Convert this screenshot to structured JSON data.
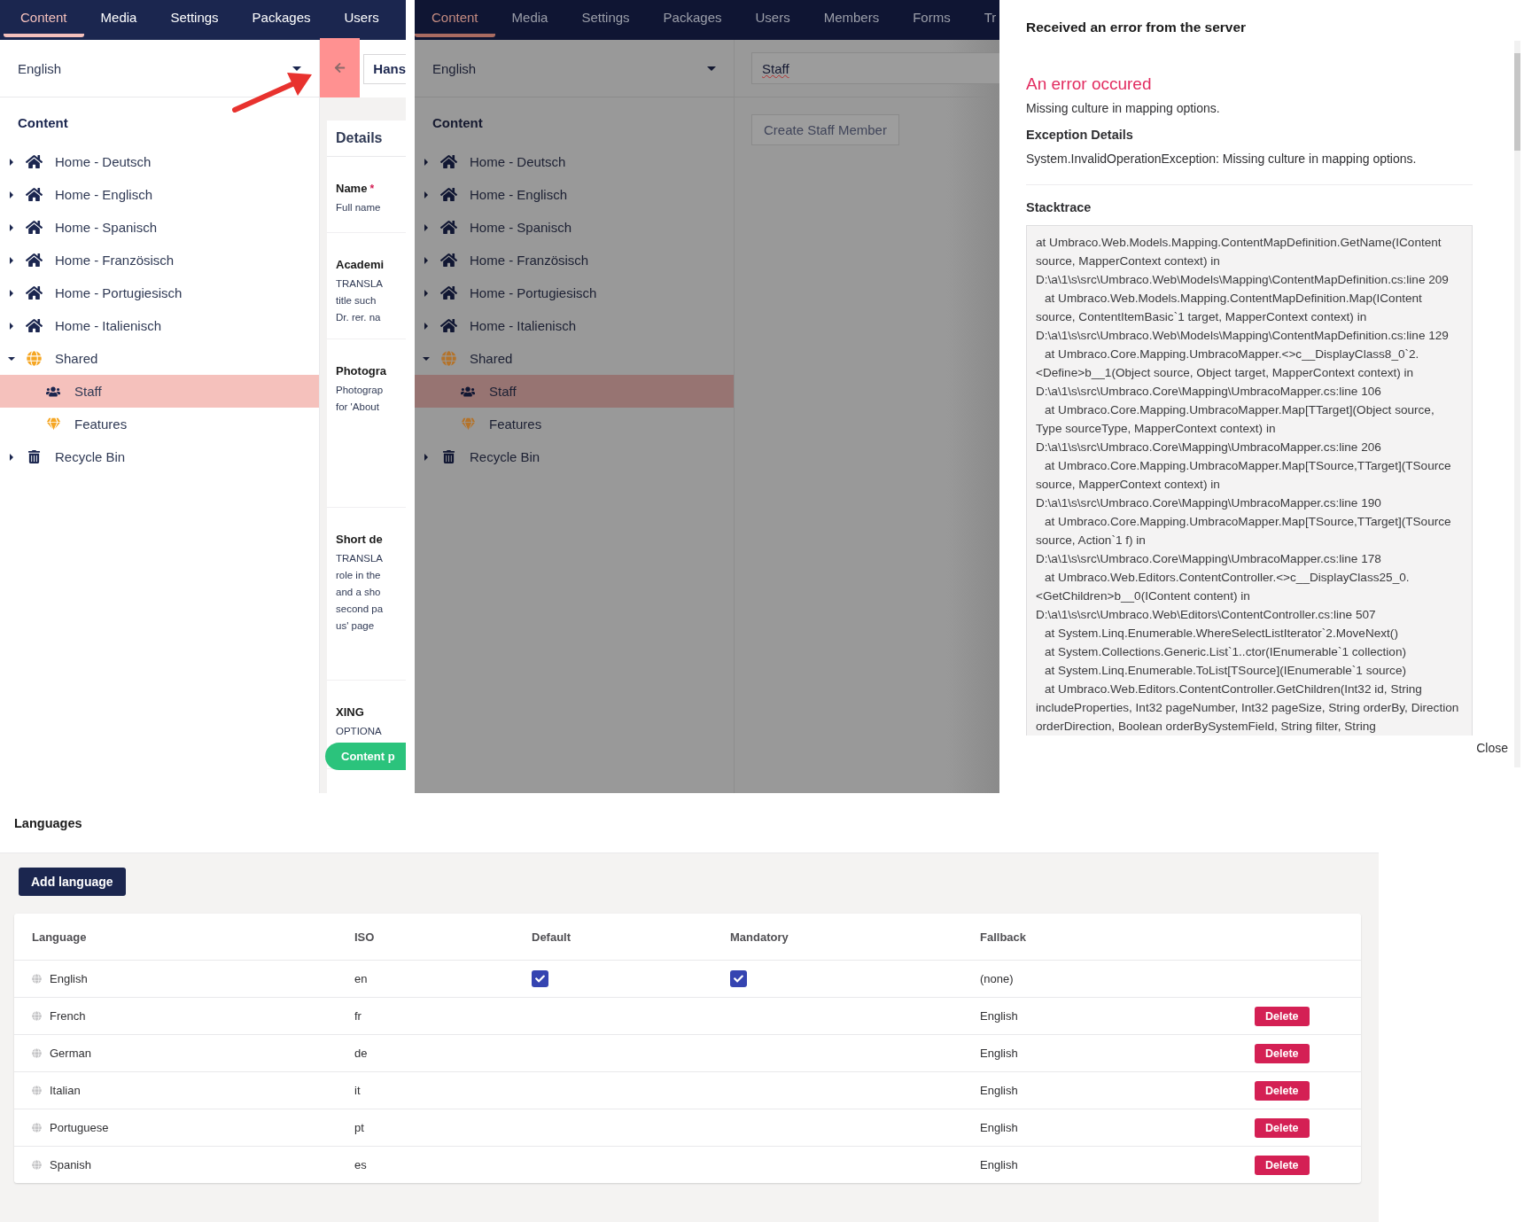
{
  "admin_view": {
    "nav_tabs": [
      {
        "label": "Content",
        "selected": true
      },
      {
        "label": "Media",
        "selected": false
      },
      {
        "label": "Settings",
        "selected": false
      },
      {
        "label": "Packages",
        "selected": false
      },
      {
        "label": "Users",
        "selected": false
      }
    ],
    "language_select": {
      "value": "English"
    },
    "tree_title": "Content",
    "tree": [
      {
        "label": "Home - Deutsch",
        "kind": "home",
        "expanded": false,
        "selected": false
      },
      {
        "label": "Home - Englisch",
        "kind": "home",
        "expanded": false,
        "selected": false
      },
      {
        "label": "Home - Spanisch",
        "kind": "home",
        "expanded": false,
        "selected": false
      },
      {
        "label": "Home - Französisch",
        "kind": "home",
        "expanded": false,
        "selected": false
      },
      {
        "label": "Home - Portugiesisch",
        "kind": "home",
        "expanded": false,
        "selected": false
      },
      {
        "label": "Home - Italienisch",
        "kind": "home",
        "expanded": false,
        "selected": false
      },
      {
        "label": "Shared",
        "kind": "globe",
        "expanded": true,
        "selected": false,
        "children": [
          {
            "label": "Staff",
            "kind": "staff",
            "selected": true
          },
          {
            "label": "Features",
            "kind": "features",
            "selected": false
          }
        ]
      },
      {
        "label": "Recycle Bin",
        "kind": "trash",
        "expanded": false,
        "selected": false
      }
    ],
    "back_button": {
      "highlighted": true
    },
    "annotation_arrow": true,
    "name_field": {
      "value": "Hans"
    },
    "editor": {
      "group_title": "Details",
      "fields": [
        {
          "label": "Name",
          "required_mark": "*",
          "description": [
            "Full name"
          ]
        },
        {
          "label": "Academi",
          "description": [
            "TRANSLA",
            "title such",
            "Dr. rer. na"
          ]
        },
        {
          "label": "Photogra",
          "description": [
            "Photograp",
            "for 'About"
          ]
        },
        {
          "label": "Short de",
          "description": [
            "TRANSLA",
            "role in the",
            "and a sho",
            "second pa",
            "us' page"
          ]
        },
        {
          "label": "XING",
          "description": [
            "OPTIONA"
          ]
        }
      ]
    },
    "save_button": "Content p"
  },
  "dimmed_view": {
    "nav_tabs": [
      {
        "label": "Content",
        "selected": true
      },
      {
        "label": "Media",
        "selected": false
      },
      {
        "label": "Settings",
        "selected": false
      },
      {
        "label": "Packages",
        "selected": false
      },
      {
        "label": "Users",
        "selected": false
      },
      {
        "label": "Members",
        "selected": false
      },
      {
        "label": "Forms",
        "selected": false
      },
      {
        "label": "Tr",
        "selected": false
      }
    ],
    "language_select": {
      "value": "English"
    },
    "tree_title": "Content",
    "tree": [
      {
        "label": "Home - Deutsch",
        "kind": "home",
        "expanded": false,
        "selected": false
      },
      {
        "label": "Home - Englisch",
        "kind": "home",
        "expanded": false,
        "selected": false
      },
      {
        "label": "Home - Spanisch",
        "kind": "home",
        "expanded": false,
        "selected": false
      },
      {
        "label": "Home - Französisch",
        "kind": "home",
        "expanded": false,
        "selected": false
      },
      {
        "label": "Home - Portugiesisch",
        "kind": "home",
        "expanded": false,
        "selected": false
      },
      {
        "label": "Home - Italienisch",
        "kind": "home",
        "expanded": false,
        "selected": false
      },
      {
        "label": "Shared",
        "kind": "globe",
        "expanded": true,
        "selected": false,
        "children": [
          {
            "label": "Staff",
            "kind": "staff",
            "selected": true
          },
          {
            "label": "Features",
            "kind": "features",
            "selected": false
          }
        ]
      },
      {
        "label": "Recycle Bin",
        "kind": "trash",
        "expanded": false,
        "selected": false
      }
    ],
    "name_field": {
      "value": "Staff"
    },
    "create_button": "Create Staff Member"
  },
  "error_dialog": {
    "title": "Received an error from the server",
    "heading": "An error occured",
    "message": "Missing culture in mapping options.",
    "exception_title": "Exception Details",
    "exception": "System.InvalidOperationException: Missing culture in mapping options.",
    "stacktrace_title": "Stacktrace",
    "stacktrace": [
      "at Umbraco.Web.Models.Mapping.ContentMapDefinition.GetName(IContent source, MapperContext context) in D:\\a\\1\\s\\src\\Umbraco.Web\\Models\\Mapping\\ContentMapDefinition.cs:line 209",
      "at Umbraco.Web.Models.Mapping.ContentMapDefinition.Map(IContent source, ContentItemBasic`1 target, MapperContext context) in D:\\a\\1\\s\\src\\Umbraco.Web\\Models\\Mapping\\ContentMapDefinition.cs:line 129",
      "at Umbraco.Core.Mapping.UmbracoMapper.<>c__DisplayClass8_0`2.<Define>b__1(Object source, Object target, MapperContext context) in D:\\a\\1\\s\\src\\Umbraco.Core\\Mapping\\UmbracoMapper.cs:line 106",
      "at Umbraco.Core.Mapping.UmbracoMapper.Map[TTarget](Object source, Type sourceType, MapperContext context) in D:\\a\\1\\s\\src\\Umbraco.Core\\Mapping\\UmbracoMapper.cs:line 206",
      "at Umbraco.Core.Mapping.UmbracoMapper.Map[TSource,TTarget](TSource source, MapperContext context) in D:\\a\\1\\s\\src\\Umbraco.Core\\Mapping\\UmbracoMapper.cs:line 190",
      "at Umbraco.Core.Mapping.UmbracoMapper.Map[TSource,TTarget](TSource source, Action`1 f) in D:\\a\\1\\s\\src\\Umbraco.Core\\Mapping\\UmbracoMapper.cs:line 178",
      "at Umbraco.Web.Editors.ContentController.<>c__DisplayClass25_0.<GetChildren>b__0(IContent content) in D:\\a\\1\\s\\src\\Umbraco.Web\\Editors\\ContentController.cs:line 507",
      "at System.Linq.Enumerable.WhereSelectListIterator`2.MoveNext()",
      "at System.Collections.Generic.List`1..ctor(IEnumerable`1 collection)",
      "at System.Linq.Enumerable.ToList[TSource](IEnumerable`1 source)",
      "at Umbraco.Web.Editors.ContentController.GetChildren(Int32 id, String includeProperties, Int32 pageNumber, Int32 pageSize, String orderBy, Direction orderDirection, Boolean orderBySystemField, String filter, String"
    ],
    "close_button": "Close"
  },
  "languages": {
    "title": "Languages",
    "add_button": "Add language",
    "columns": [
      "Language",
      "ISO",
      "Default",
      "Mandatory",
      "Fallback"
    ],
    "rows": [
      {
        "language": "English",
        "iso": "en",
        "default": true,
        "mandatory": true,
        "fallback": "(none)"
      },
      {
        "language": "French",
        "iso": "fr",
        "default": false,
        "mandatory": false,
        "fallback": "English",
        "action": "Delete"
      },
      {
        "language": "German",
        "iso": "de",
        "default": false,
        "mandatory": false,
        "fallback": "English",
        "action": "Delete"
      },
      {
        "language": "Italian",
        "iso": "it",
        "default": false,
        "mandatory": false,
        "fallback": "English",
        "action": "Delete"
      },
      {
        "language": "Portuguese",
        "iso": "pt",
        "default": false,
        "mandatory": false,
        "fallback": "English",
        "action": "Delete"
      },
      {
        "language": "Spanish",
        "iso": "es",
        "default": false,
        "mandatory": false,
        "fallback": "English",
        "action": "Delete"
      }
    ]
  }
}
